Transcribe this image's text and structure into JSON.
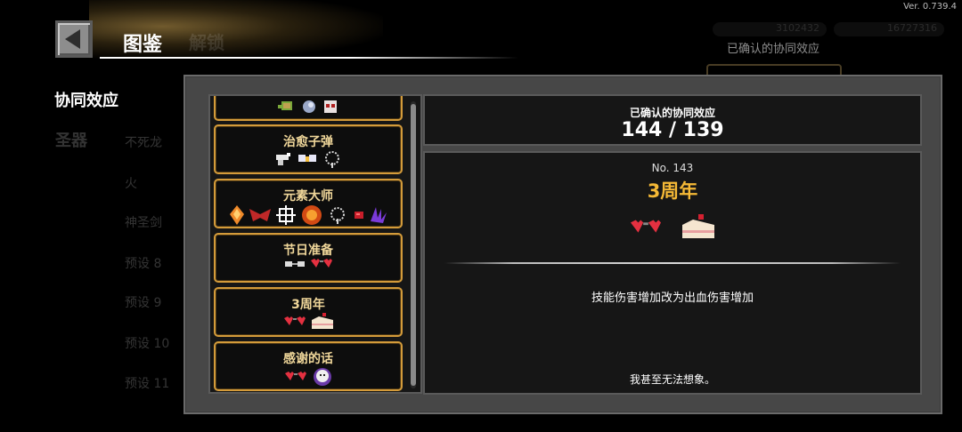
{
  "version": "Ver. 0.739.4",
  "header": {
    "title": "图鉴",
    "faded_tab": "解锁"
  },
  "background": {
    "currency_1": "3102432",
    "currency_2": "16727316",
    "note": "已确认的协同效应",
    "sidebar_active": "协同效应",
    "sidebar_dim": "圣器",
    "list_items": [
      "不死龙",
      "火",
      "神圣剑",
      "预设 8",
      "预设 9",
      "预设 10",
      "预设 11"
    ]
  },
  "synergy_list": [
    {
      "name": "",
      "icons": [
        "turtle-icon",
        "moon-orb-icon",
        "mask-icon"
      ]
    },
    {
      "name": "治愈子弹",
      "icons": [
        "pistol-icon",
        "wings-icon",
        "rosary-icon"
      ]
    },
    {
      "name": "元素大师",
      "icons": [
        "fire-crystal-icon",
        "bat-wing-icon",
        "snowflake-icon",
        "fireball-icon",
        "rosary-icon",
        "red-gem-icon",
        "purple-claw-icon"
      ]
    },
    {
      "name": "节日准备",
      "icons": [
        "white-glasses-icon",
        "heart-glasses-icon"
      ]
    },
    {
      "name": "3周年",
      "icons": [
        "heart-glasses-icon",
        "cake-icon"
      ]
    },
    {
      "name": "感谢的话",
      "icons": [
        "heart-glasses-icon",
        "ghost-icon"
      ]
    }
  ],
  "summary": {
    "label": "已确认的协同效应",
    "count": "144 / 139"
  },
  "detail": {
    "number": "No. 143",
    "title": "3周年",
    "icons": [
      "heart-glasses-icon",
      "cake-icon"
    ],
    "effect": "技能伤害增加改为出血伤害增加",
    "quote": "我甚至无法想象。"
  },
  "colors": {
    "card_border": "#d49b3a",
    "title_orange": "#f5b936",
    "panel_bg": "#474747"
  }
}
